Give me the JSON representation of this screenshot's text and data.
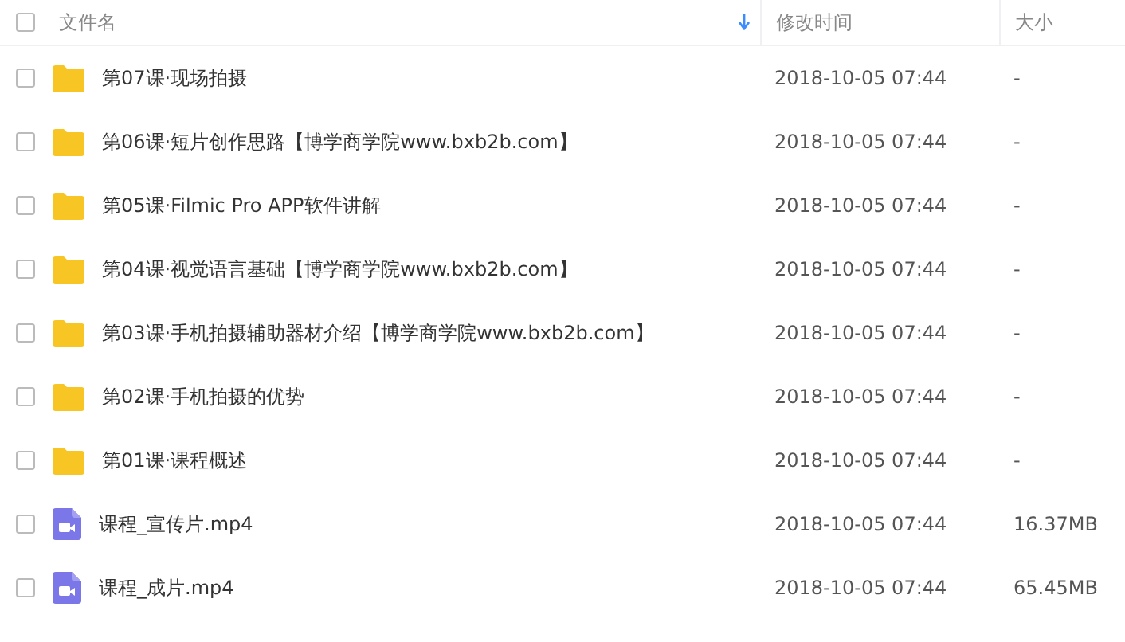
{
  "header": {
    "select_all": {
      "checked": false
    },
    "columns": [
      {
        "label": "文件名",
        "sorted": true
      },
      {
        "label": "修改时间",
        "sorted": false
      },
      {
        "label": "大小",
        "sorted": false
      }
    ]
  },
  "files": [
    {
      "kind": "folder",
      "name": "第07课·现场拍摄",
      "modified": "2018-10-05 07:44",
      "size": "-",
      "checked": false
    },
    {
      "kind": "folder",
      "name": "第06课·短片创作思路【博学商学院www.bxb2b.com】",
      "modified": "2018-10-05 07:44",
      "size": "-",
      "checked": false
    },
    {
      "kind": "folder",
      "name": "第05课·Filmic Pro APP软件讲解",
      "modified": "2018-10-05 07:44",
      "size": "-",
      "checked": false
    },
    {
      "kind": "folder",
      "name": "第04课·视觉语言基础【博学商学院www.bxb2b.com】",
      "modified": "2018-10-05 07:44",
      "size": "-",
      "checked": false
    },
    {
      "kind": "folder",
      "name": "第03课·手机拍摄辅助器材介绍【博学商学院www.bxb2b.com】",
      "modified": "2018-10-05 07:44",
      "size": "-",
      "checked": false
    },
    {
      "kind": "folder",
      "name": "第02课·手机拍摄的优势",
      "modified": "2018-10-05 07:44",
      "size": "-",
      "checked": false
    },
    {
      "kind": "folder",
      "name": "第01课·课程概述",
      "modified": "2018-10-05 07:44",
      "size": "-",
      "checked": false
    },
    {
      "kind": "video",
      "name": "课程_宣传片.mp4",
      "modified": "2018-10-05 07:44",
      "size": "16.37MB",
      "checked": false
    },
    {
      "kind": "video",
      "name": "课程_成片.mp4",
      "modified": "2018-10-05 07:44",
      "size": "65.45MB",
      "checked": false
    }
  ]
}
